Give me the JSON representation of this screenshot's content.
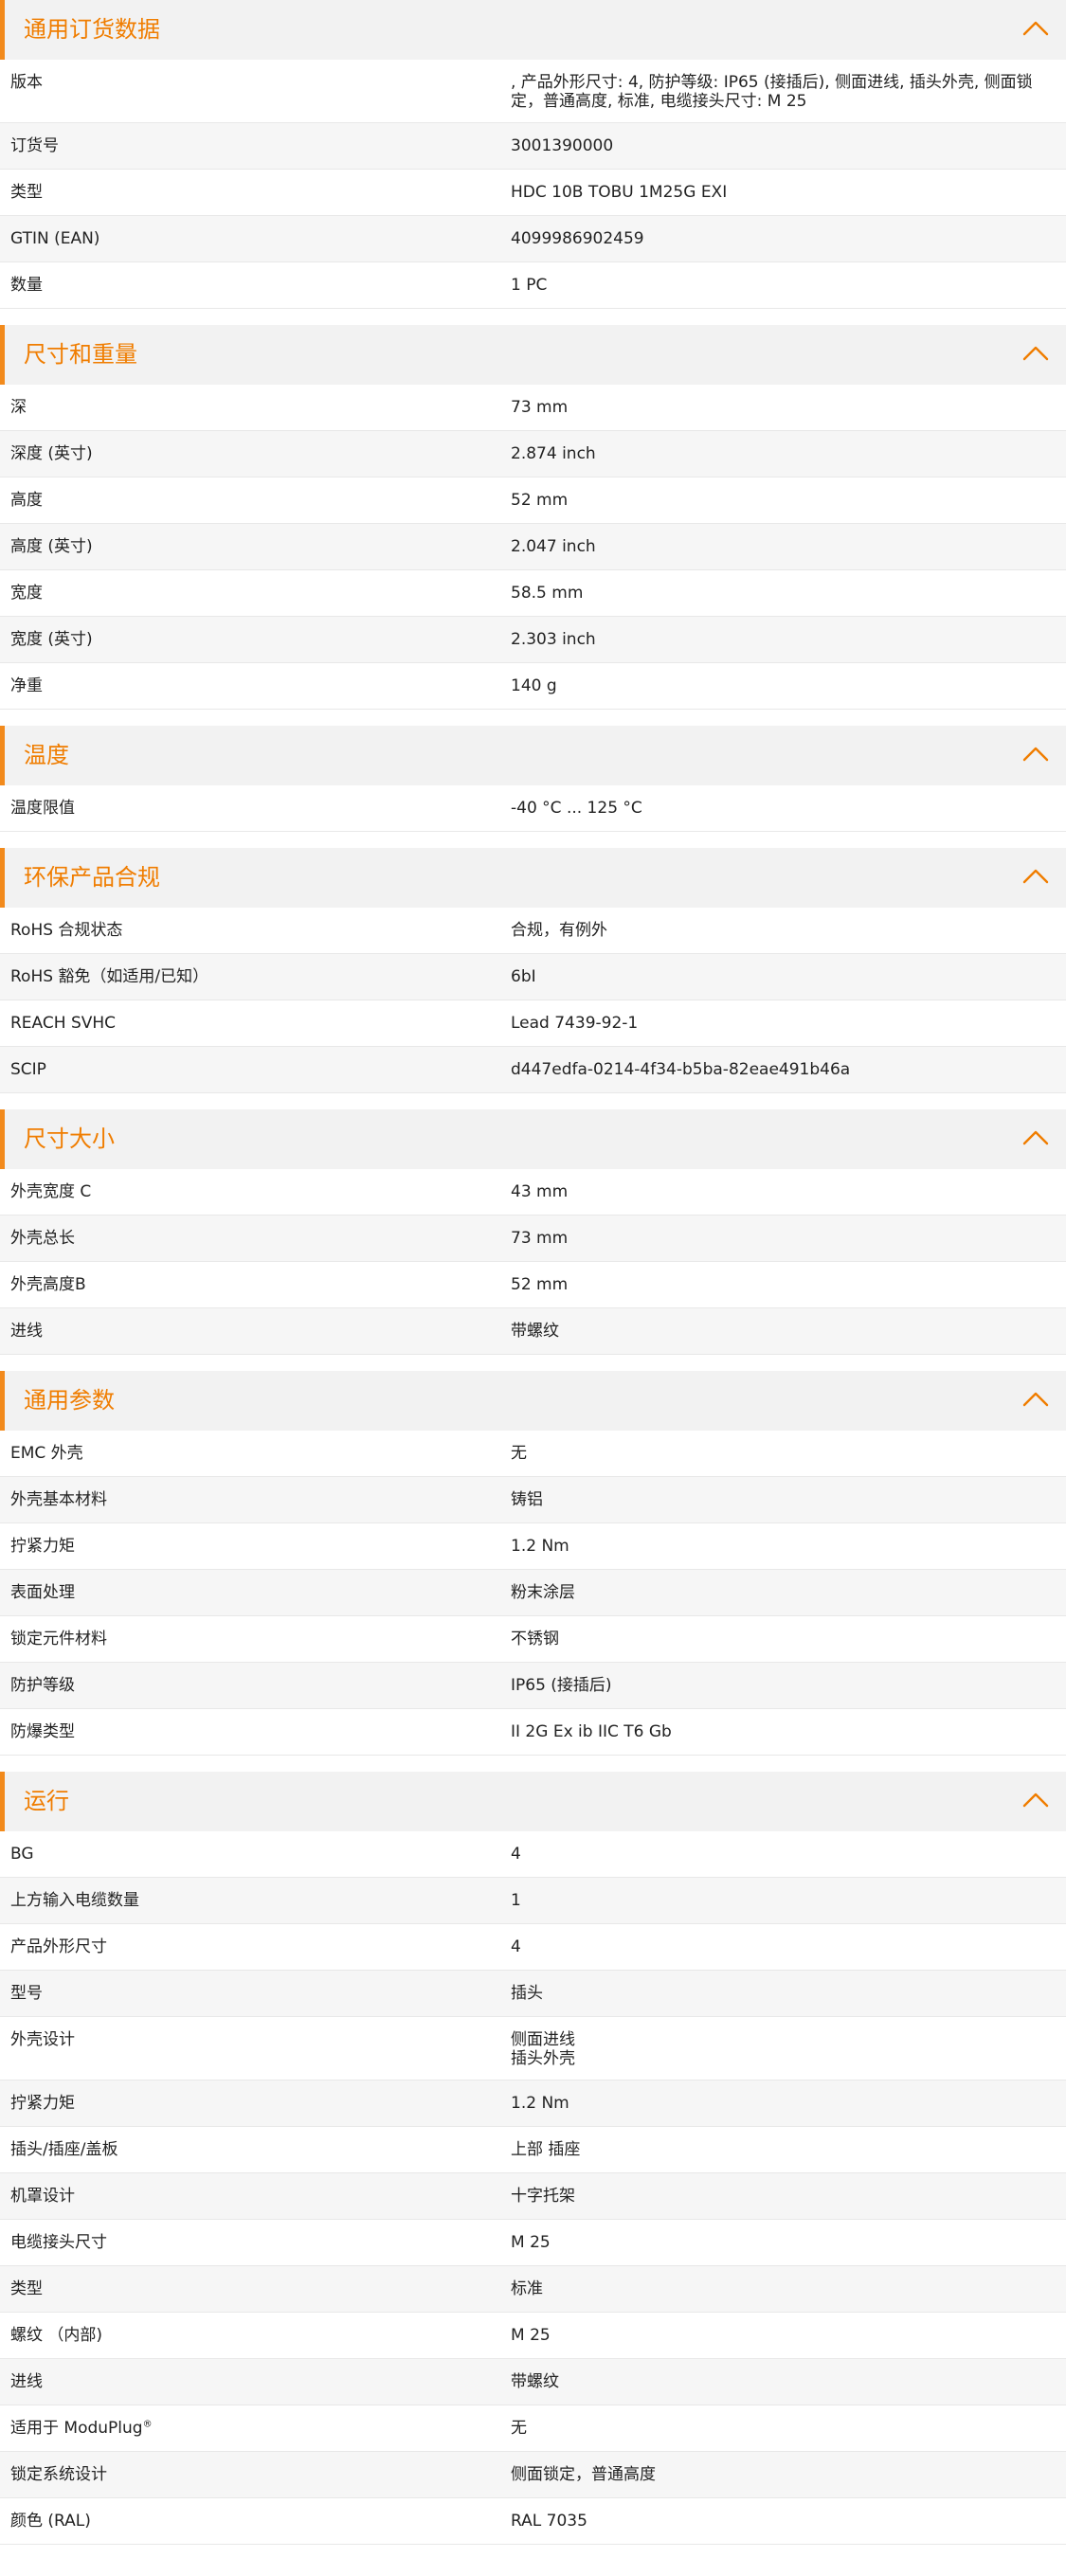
{
  "accent_color": "#f07d00",
  "collapse_icon": "chevron-up-icon",
  "sections": [
    {
      "title": "通用订货数据",
      "rows": [
        {
          "label": "版本",
          "value": ", 产品外形尺寸: 4, 防护等级: IP65 (接插后), 侧面进线, 插头外壳, 侧面锁定，普通高度, 标准, 电缆接头尺寸: M 25"
        },
        {
          "label": "订货号",
          "value": "3001390000"
        },
        {
          "label": "类型",
          "value": "HDC 10B TOBU 1M25G EXI"
        },
        {
          "label": "GTIN (EAN)",
          "value": "4099986902459"
        },
        {
          "label": "数量",
          "value": "1  PC"
        }
      ]
    },
    {
      "title": "尺寸和重量",
      "rows": [
        {
          "label": "深",
          "value": "73  mm"
        },
        {
          "label": "深度 (英寸)",
          "value": "2.874  inch"
        },
        {
          "label": "高度",
          "value": "52  mm"
        },
        {
          "label": "高度 (英寸)",
          "value": "2.047  inch"
        },
        {
          "label": "宽度",
          "value": "58.5  mm"
        },
        {
          "label": "宽度 (英寸)",
          "value": "2.303  inch"
        },
        {
          "label": "净重",
          "value": "140  g"
        }
      ]
    },
    {
      "title": "温度",
      "rows": [
        {
          "label": "温度限值",
          "value": "-40 °C ... 125 °C"
        }
      ]
    },
    {
      "title": "环保产品合规",
      "rows": [
        {
          "label": "RoHS 合规状态",
          "value": "合规，有例外"
        },
        {
          "label": "RoHS 豁免（如适用/已知）",
          "value": "6bI"
        },
        {
          "label": "REACH SVHC",
          "value": "Lead 7439-92-1"
        },
        {
          "label": "SCIP",
          "value": "d447edfa-0214-4f34-b5ba-82eae491b46a"
        }
      ]
    },
    {
      "title": "尺寸大小",
      "rows": [
        {
          "label": "外壳宽度 C",
          "value": "43  mm"
        },
        {
          "label": "外壳总长",
          "value": "73  mm"
        },
        {
          "label": "外壳高度B",
          "value": "52  mm"
        },
        {
          "label": "进线",
          "value": "带螺纹"
        }
      ]
    },
    {
      "title": "通用参数",
      "rows": [
        {
          "label": "EMC 外壳",
          "value": "无"
        },
        {
          "label": "外壳基本材料",
          "value": "铸铝"
        },
        {
          "label": "拧紧力矩",
          "value": "1.2  Nm"
        },
        {
          "label": "表面处理",
          "value": "粉末涂层"
        },
        {
          "label": "锁定元件材料",
          "value": "不锈钢"
        },
        {
          "label": "防护等级",
          "value": "IP65 (接插后)"
        },
        {
          "label": "防爆类型",
          "value": "II 2G Ex ib IIC T6 Gb"
        }
      ]
    },
    {
      "title": "运行",
      "rows": [
        {
          "label": "BG",
          "value": "4"
        },
        {
          "label": "上方输入电缆数量",
          "value": "1"
        },
        {
          "label": "产品外形尺寸",
          "value": "4"
        },
        {
          "label": "型号",
          "value": "插头"
        },
        {
          "label": "外壳设计",
          "value": "侧面进线\n插头外壳"
        },
        {
          "label": "拧紧力矩",
          "value": "1.2  Nm"
        },
        {
          "label": "插头/插座/盖板",
          "value": "上部 插座"
        },
        {
          "label": "机罩设计",
          "value": "十字托架"
        },
        {
          "label": "电缆接头尺寸",
          "value": "M 25"
        },
        {
          "label": "类型",
          "value": "标准"
        },
        {
          "label": "螺纹 （内部)",
          "value": "M 25"
        },
        {
          "label": "进线",
          "value": "带螺纹"
        },
        {
          "label": "适用于 ModuPlug",
          "label_sup": "®",
          "value": "无"
        },
        {
          "label": "锁定系统设计",
          "value": "侧面锁定，普通高度"
        },
        {
          "label": "颜色 (RAL)",
          "value": "RAL 7035"
        }
      ]
    }
  ]
}
